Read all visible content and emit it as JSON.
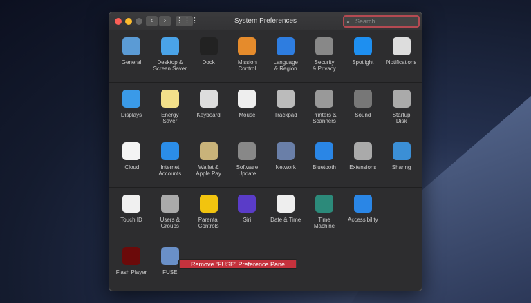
{
  "window": {
    "title": "System Preferences",
    "search_placeholder": "Search"
  },
  "rows": [
    [
      {
        "label": "General",
        "color": "#5b9bd5"
      },
      {
        "label": "Desktop &\nScreen Saver",
        "color": "#4aa3e8"
      },
      {
        "label": "Dock",
        "color": "#222"
      },
      {
        "label": "Mission\nControl",
        "color": "#e58b2c"
      },
      {
        "label": "Language\n& Region",
        "color": "#2e7de0"
      },
      {
        "label": "Security\n& Privacy",
        "color": "#888"
      },
      {
        "label": "Spotlight",
        "color": "#1e8ff0"
      },
      {
        "label": "Notifications",
        "color": "#ddd"
      }
    ],
    [
      {
        "label": "Displays",
        "color": "#3a9ae8"
      },
      {
        "label": "Energy\nSaver",
        "color": "#f3e08a"
      },
      {
        "label": "Keyboard",
        "color": "#ddd"
      },
      {
        "label": "Mouse",
        "color": "#eee"
      },
      {
        "label": "Trackpad",
        "color": "#bbb"
      },
      {
        "label": "Printers &\nScanners",
        "color": "#999"
      },
      {
        "label": "Sound",
        "color": "#777"
      },
      {
        "label": "Startup\nDisk",
        "color": "#aaa"
      }
    ],
    [
      {
        "label": "iCloud",
        "color": "#f4f4f4"
      },
      {
        "label": "Internet\nAccounts",
        "color": "#2b8de8"
      },
      {
        "label": "Wallet &\nApple Pay",
        "color": "#c9b37a"
      },
      {
        "label": "Software\nUpdate",
        "color": "#888"
      },
      {
        "label": "Network",
        "color": "#6a7fa8"
      },
      {
        "label": "Bluetooth",
        "color": "#2a86e6"
      },
      {
        "label": "Extensions",
        "color": "#aaa"
      },
      {
        "label": "Sharing",
        "color": "#3b8fd6"
      }
    ],
    [
      {
        "label": "Touch ID",
        "color": "#f0f0f0"
      },
      {
        "label": "Users &\nGroups",
        "color": "#aaa"
      },
      {
        "label": "Parental\nControls",
        "color": "#f2c40f"
      },
      {
        "label": "Siri",
        "color": "#5a3cc8"
      },
      {
        "label": "Date & Time",
        "color": "#eee"
      },
      {
        "label": "Time\nMachine",
        "color": "#2c8a7a"
      },
      {
        "label": "Accessibility",
        "color": "#2a86e6"
      }
    ],
    [
      {
        "label": "Flash Player",
        "color": "#6b0a0a"
      },
      {
        "label": "FUSE",
        "color": "#6a90c8"
      }
    ]
  ],
  "context_menu": {
    "item": "Remove “FUSE” Preference Pane"
  }
}
